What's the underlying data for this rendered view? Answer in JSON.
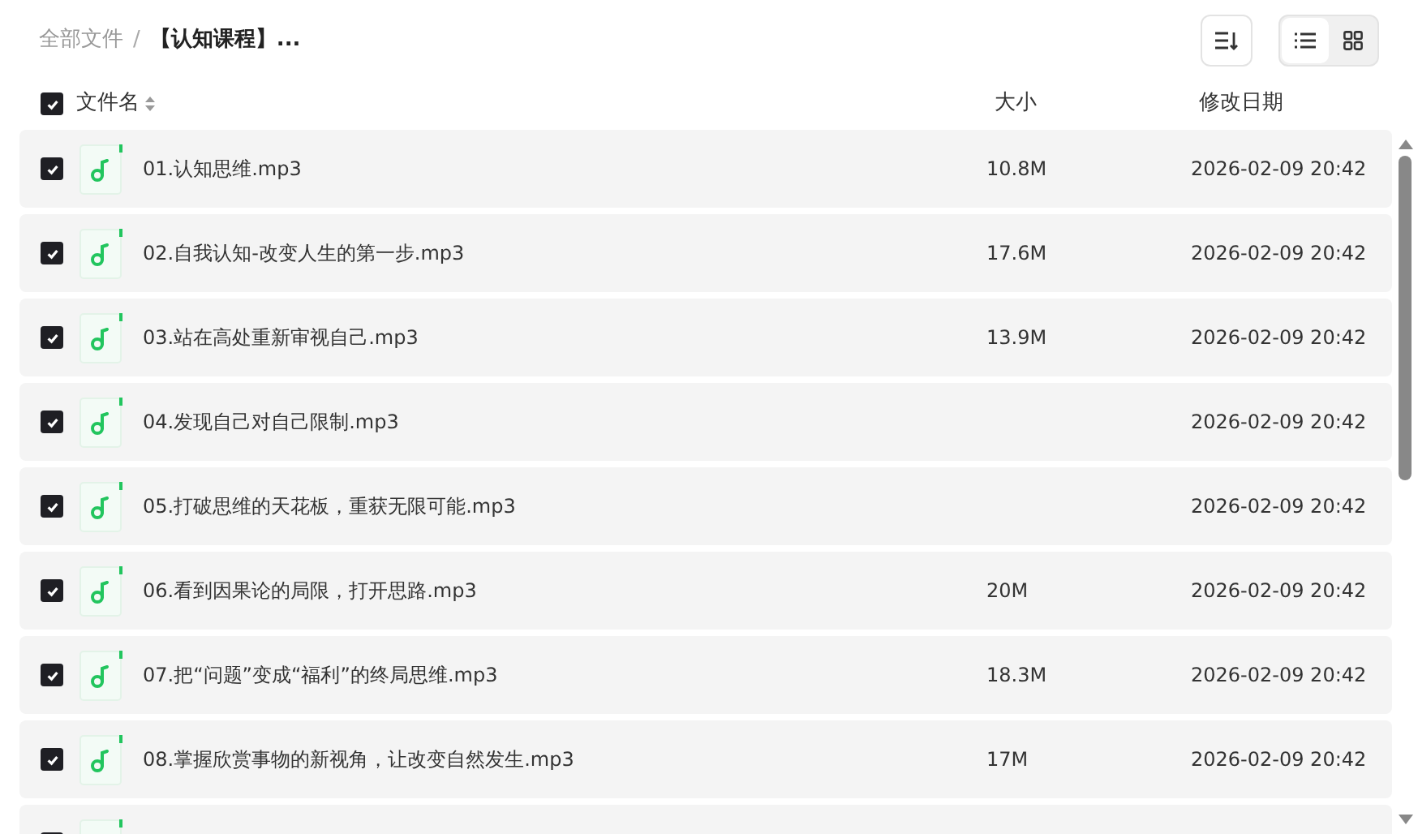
{
  "breadcrumb": [
    {
      "label": "全部文件"
    },
    {
      "label": "【认知课程】..."
    }
  ],
  "breadcrumb_separator": "/",
  "view_toggle": [
    {
      "kind": "list",
      "selected": true
    },
    {
      "kind": "grid",
      "selected": false
    }
  ],
  "header": {
    "checked": true,
    "columns": [
      "文件名",
      "大小",
      "修改日期"
    ]
  },
  "rows": [
    {
      "checked": true,
      "name": "01.认知思维.mp3",
      "size": "10.8M",
      "date": "2026-02-09 20:42"
    },
    {
      "checked": true,
      "name": "02.自我认知-改变人生的第一步.mp3",
      "size": "17.6M",
      "date": "2026-02-09 20:42"
    },
    {
      "checked": true,
      "name": "03.站在高处重新审视自己.mp3",
      "size": "13.9M",
      "date": "2026-02-09 20:42"
    },
    {
      "checked": true,
      "name": "04.发现自己对自己限制.mp3",
      "date": "2026-02-09 20:42"
    },
    {
      "checked": true,
      "name": "05.打破思维的天花板，重获无限可能.mp3",
      "date": "2026-02-09 20:42"
    },
    {
      "checked": true,
      "name": "06.看到因果论的局限，打开思路.mp3",
      "size": "20M",
      "date": "2026-02-09 20:42"
    },
    {
      "checked": true,
      "name": "07.把“问题”变成“福利”的终局思维.mp3",
      "size": "18.3M",
      "date": "2026-02-09 20:42"
    },
    {
      "checked": true,
      "name": "08.掌握欣赏事物的新视角，让改变自然发生.mp3",
      "size": "17M",
      "date": "2026-02-09 20:42"
    },
    {
      "checked": true
    }
  ]
}
